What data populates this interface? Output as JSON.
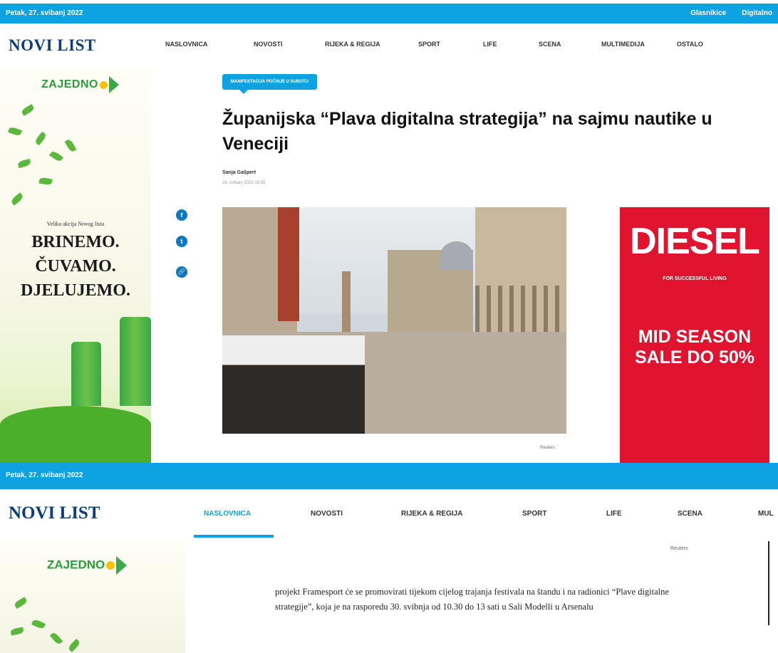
{
  "topbar": {
    "date": "Petak, 27. svibanj 2022",
    "links": [
      "Glasnikice",
      "Digitalno"
    ]
  },
  "header": {
    "logo": "NOVI LIST",
    "nav": [
      "NASLOVNICA",
      "NOVOSTI",
      "RIJEKA & REGIJA",
      "SPORT",
      "LIFE",
      "SCENA",
      "MULTIMEDIJA",
      "OSTALO"
    ]
  },
  "left_ad": {
    "brand": "ZAJEDNO",
    "small_text": "Velika akcija Novog lista",
    "lines": [
      "BRINEMO.",
      "ČUVAMO.",
      "DJELUJEMO."
    ]
  },
  "article": {
    "tag": "MANIFESTACIJA POČINJE U SUBOTU",
    "headline": "Županijska “Plava digitalna strategija” na sajmu nautike u Veneciji",
    "author": "Sanja Gašpert",
    "date": "26. svibanj 2022 15:05",
    "photo_credit": "Reuters"
  },
  "share": [
    "f",
    "t",
    "🔗"
  ],
  "right_ad": {
    "brand": "DIESEL",
    "slogan": "FOR SUCCESSFUL LIVING",
    "sale": "MID SEASON SALE DO 50%"
  },
  "capture2": {
    "date": "Petak, 27. svibanj 2022",
    "logo": "NOVI LIST",
    "nav": [
      "NASLOVNICA",
      "NOVOSTI",
      "RIJEKA & REGIJA",
      "SPORT",
      "LIFE",
      "SCENA",
      "MUL"
    ],
    "ad_brand": "ZAJEDNO",
    "photo_credit": "Reuters",
    "body": "projekt Framesport će se promovirati tijekom cijelog trajanja festivala na štandu i na radionici “Plave digitalne strategije”, koja je na rasporedu 30. svibnja od 10.30 do 13 sati u Sali Modelli u Arsenalu"
  },
  "colors": {
    "accent": "#0da3e2",
    "logo": "#0b3d7a",
    "diesel_red": "#e0142f",
    "ad_green": "#3aa844"
  }
}
